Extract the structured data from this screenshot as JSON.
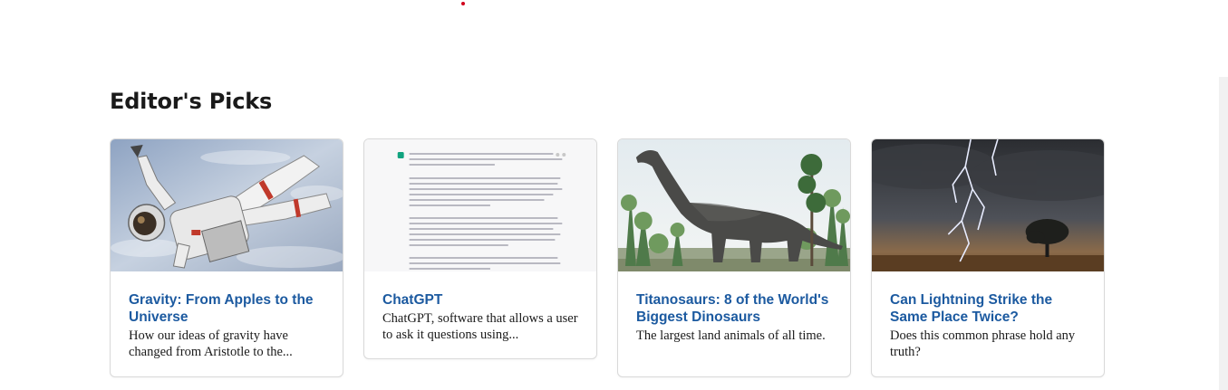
{
  "section": {
    "title": "Editor's Picks"
  },
  "cards": [
    {
      "title": "Gravity: From Apples to the Universe",
      "description": "How our ideas of gravity have changed from Aristotle to the..."
    },
    {
      "title": "ChatGPT",
      "description": "ChatGPT, software that allows a user to ask it questions using..."
    },
    {
      "title": "Titanosaurs: 8 of the World's Biggest Dinosaurs",
      "description": "The largest land animals of all time."
    },
    {
      "title": "Can Lightning Strike the Same Place Twice?",
      "description": "Does this common phrase hold any truth?"
    }
  ],
  "colors": {
    "link": "#1c5aa0",
    "text": "#1a1a1a",
    "accent_dot": "#d0021b"
  }
}
